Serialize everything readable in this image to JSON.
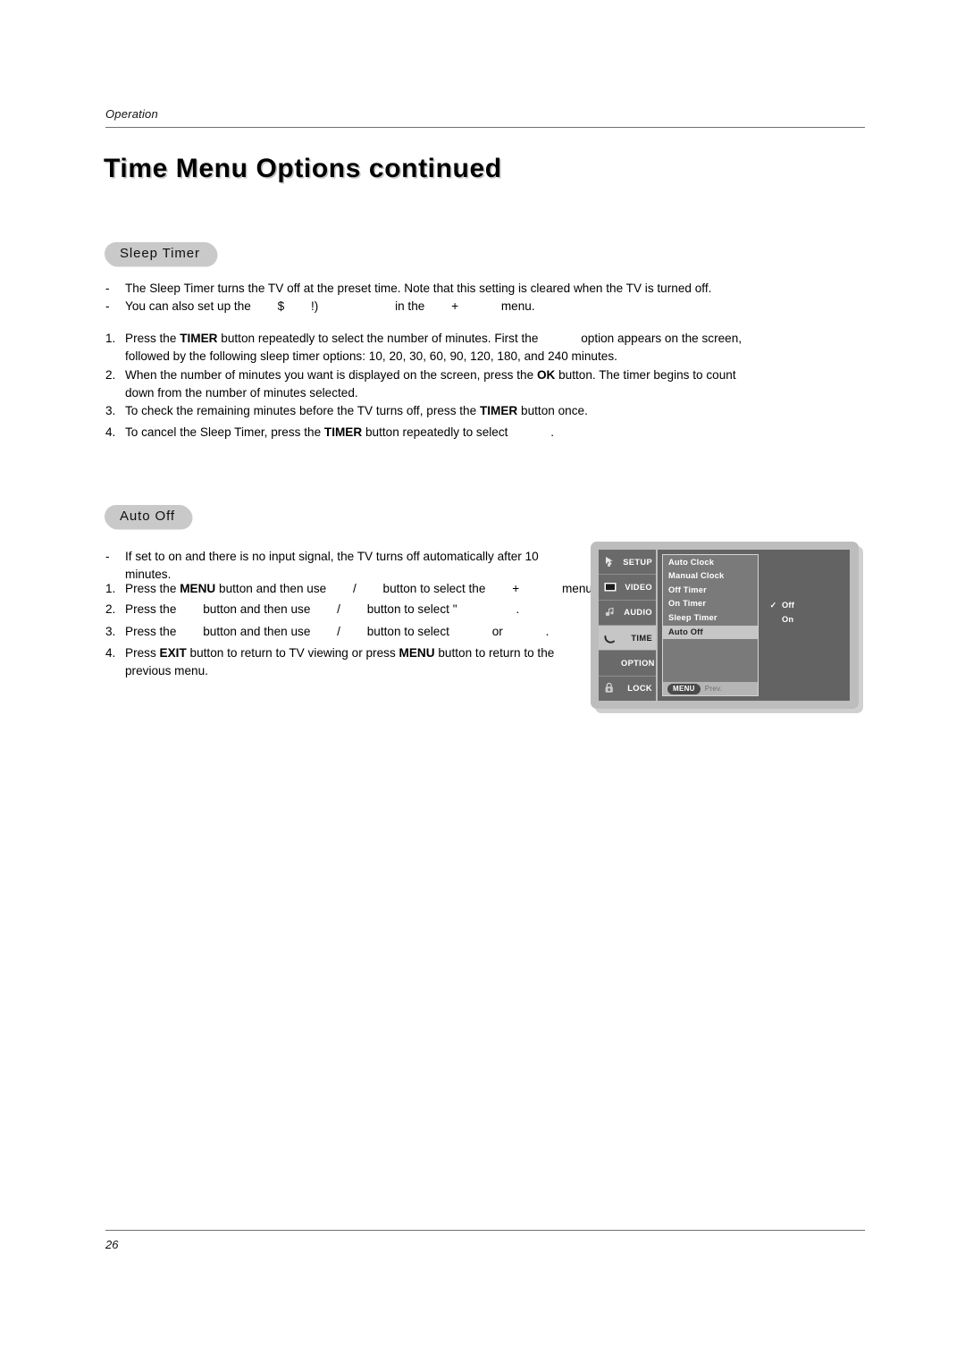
{
  "header": {
    "running_head": "Operation",
    "title": "Time Menu Options continued"
  },
  "sections": [
    {
      "badge": "Sleep Timer",
      "bullets": [
        "The Sleep Timer turns the TV off at the preset time. Note that this setting is cleared when the TV is turned off.",
        "You can also set up the $   !)        in the  +     menu."
      ],
      "steps": [
        "1.",
        "2.",
        "3.",
        "4."
      ]
    },
    {
      "badge": "Auto Off"
    }
  ],
  "sleep_timer": {
    "badge": "Sleep Timer",
    "bullet_mark": "-",
    "bullet1": "The Sleep Timer turns the TV off at the preset time. Note that this setting is cleared when the TV is turned off.",
    "bullet2_a": "You can also set up the",
    "bullet2_glyph1": "$",
    "bullet2_glyph2": "!)",
    "bullet2_b": "in the",
    "bullet2_glyph3": "+",
    "bullet2_c": "menu.",
    "step1_num": "1.",
    "step1_a": "Press the",
    "step1_key": "TIMER",
    "step1_b": "button repeatedly to select the number of minutes. First the",
    "step1_c": "option appears on the screen,",
    "step1_line2": "followed by the following sleep timer options: 10, 20, 30, 60, 90, 120, 180, and 240 minutes.",
    "step2_num": "2.",
    "step2_a": "When the number of minutes you want is displayed on the screen, press the",
    "step2_key": "OK",
    "step2_b": "button. The timer begins to count",
    "step2_line2": "down from the number of minutes selected.",
    "step3_num": "3.",
    "step3_a": "To check the remaining minutes before the TV turns off, press the",
    "step3_key": "TIMER",
    "step3_b": "button once.",
    "step4_num": "4.",
    "step4_a": "To cancel the Sleep Timer, press the",
    "step4_key": "TIMER",
    "step4_b": "button repeatedly to select",
    "step4_c": "."
  },
  "auto_off": {
    "badge": "Auto Off",
    "bullet_mark": "-",
    "bullet1_line1": "If set to on and there is no input signal, the TV turns off automatically after 10",
    "bullet1_line2": "minutes.",
    "step1_num": "1.",
    "step1_a": "Press the",
    "step1_key": "MENU",
    "step1_b": "button and then use",
    "step1_glyph_slash": "/",
    "step1_c": "button to select the",
    "step1_glyph_plus": "+",
    "step1_d": "menu.",
    "step2_num": "2.",
    "step2_a": "Press the",
    "step2_b": "button and then use",
    "step2_glyph_slash": "/",
    "step2_c": "button to select",
    "step2_glyph_quote": "\"",
    "step2_d": ".",
    "step3_num": "3.",
    "step3_a": "Press the",
    "step3_b": "button and then use",
    "step3_glyph_slash": "/",
    "step3_c": "button to select",
    "step3_d": "or",
    "step3_e": ".",
    "step4_num": "4.",
    "step4_a": "Press",
    "step4_key1": "EXIT",
    "step4_b": "button to return to TV viewing or press",
    "step4_key2": "MENU",
    "step4_c": "button to return to the",
    "step4_line2": "previous menu."
  },
  "osd": {
    "rail": [
      {
        "label": "SETUP",
        "icon": "pointer-icon",
        "active": false
      },
      {
        "label": "VIDEO",
        "icon": "screen-icon",
        "active": false
      },
      {
        "label": "AUDIO",
        "icon": "speaker-icon",
        "active": false
      },
      {
        "label": "TIME",
        "icon": "clock-arc-icon",
        "active": true
      },
      {
        "label": "OPTION",
        "icon": "none",
        "active": false
      },
      {
        "label": "LOCK",
        "icon": "padlock-icon",
        "active": false
      }
    ],
    "menu_items": [
      {
        "label": "Auto Clock",
        "selected": false
      },
      {
        "label": "Manual Clock",
        "selected": false
      },
      {
        "label": "Off Timer",
        "selected": false
      },
      {
        "label": "On Timer",
        "selected": false
      },
      {
        "label": "Sleep Timer",
        "selected": false
      }
    ],
    "selected_item": "Auto Off",
    "values": [
      {
        "label": "Off",
        "check": "✓"
      },
      {
        "label": "On",
        "check": "✓"
      }
    ],
    "footer": {
      "menu_chip": "MENU",
      "prev_label": "Prev."
    }
  },
  "footer": {
    "page_number": "26"
  },
  "colors": {
    "badge_gray": "#c9c9c9",
    "osd_bezel": "#bdbdbd",
    "osd_body": "#636363",
    "osd_rail": "#6a6a6a",
    "osd_list": "#7a7a7a",
    "osd_highlight": "#c6c6c6",
    "text_black": "#000000"
  }
}
